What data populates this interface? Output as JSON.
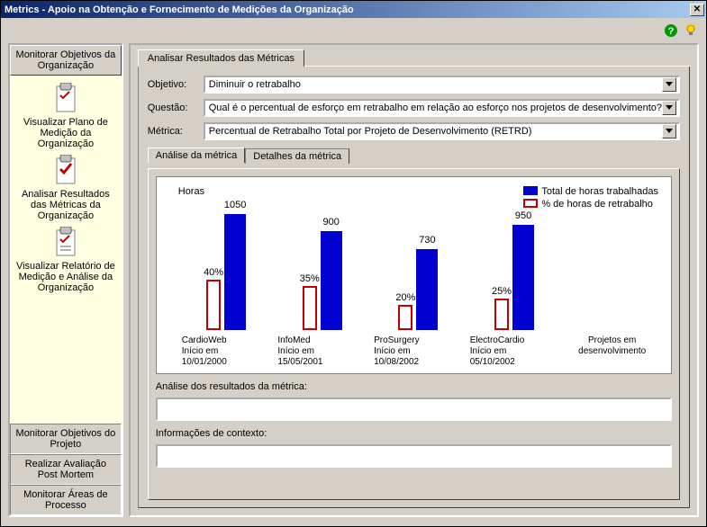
{
  "window": {
    "title": "Metrics - Apoio na Obtenção e Fornecimento de Medições da Organização"
  },
  "toolbar": {
    "help": "help-icon",
    "tip": "lightbulb-icon"
  },
  "sidebar": {
    "top_tab": "Monitorar Objetivos da Organização",
    "items": [
      {
        "label": "Visualizar Plano de Medição da Organização"
      },
      {
        "label": "Analisar Resultados das Métricas da Organização"
      },
      {
        "label": "Visualizar Relatório de Medição e Análise da Organização"
      }
    ],
    "bottom_tabs": [
      "Monitorar Objetivos do Projeto",
      "Realizar Avaliação Post Mortem",
      "Monitorar Áreas de Processo"
    ]
  },
  "main_tab": "Analisar Resultados das Métricas",
  "form": {
    "objetivo_label": "Objetivo:",
    "objetivo_value": "Diminuir o retrabalho",
    "questao_label": "Questão:",
    "questao_value": "Qual é o percentual de esforço em retrabalho em relação ao esforço nos projetos de desenvolvimento?",
    "metrica_label": "Métrica:",
    "metrica_value": "Percentual de Retrabalho Total por Projeto de Desenvolvimento (RETRD)"
  },
  "subtabs": {
    "active": "Análise da métrica",
    "inactive": "Detalhes da métrica"
  },
  "chart_data": {
    "type": "bar",
    "ylabel": "Horas",
    "xlabel": "Projetos em desenvolvimento",
    "legend": [
      {
        "name": "Total de horas trabalhadas",
        "style": "filled-blue"
      },
      {
        "name": "% de horas de retrabalho",
        "style": "outlined-red"
      }
    ],
    "categories": [
      {
        "name": "CardioWeb",
        "sub": "Início em",
        "date": "10/01/2000"
      },
      {
        "name": "InfoMed",
        "sub": "Início em",
        "date": "15/05/2001"
      },
      {
        "name": "ProSurgery",
        "sub": "Início em",
        "date": "10/08/2002"
      },
      {
        "name": "ElectroCardio",
        "sub": "Início em",
        "date": "05/10/2002"
      }
    ],
    "series": [
      {
        "name": "Total de horas trabalhadas",
        "values": [
          1050,
          900,
          730,
          950
        ]
      },
      {
        "name": "% de horas de retrabalho",
        "values": [
          "40%",
          "35%",
          "20%",
          "25%"
        ]
      }
    ],
    "ylim": [
      0,
      1100
    ]
  },
  "analysis": {
    "label": "Análise dos resultados da métrica:",
    "value": ""
  },
  "context": {
    "label": "Informações de contexto:",
    "value": ""
  }
}
